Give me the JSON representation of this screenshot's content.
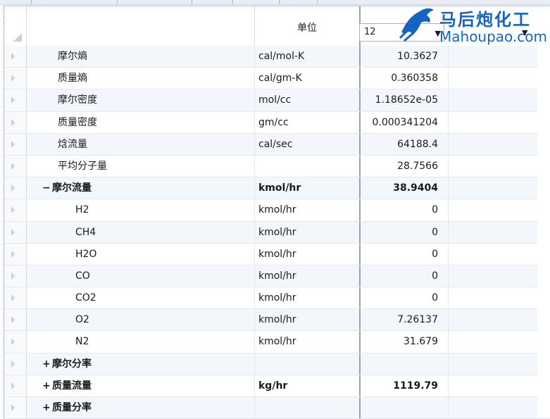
{
  "header": {
    "unit_label": "单位",
    "combo_value": "12"
  },
  "logo": {
    "name": "马后炮化工",
    "url": "Mahoupao.com"
  },
  "rows": [
    {
      "name": "摩尔熵",
      "unit": "cal/mol-K",
      "value": "10.3627",
      "level": 1
    },
    {
      "name": "质量熵",
      "unit": "cal/gm-K",
      "value": "0.360358",
      "level": 1
    },
    {
      "name": "摩尔密度",
      "unit": "mol/cc",
      "value": "1.18652e-05",
      "level": 1
    },
    {
      "name": "质量密度",
      "unit": "gm/cc",
      "value": "0.000341204",
      "level": 1
    },
    {
      "name": "焓流量",
      "unit": "cal/sec",
      "value": "64188.4",
      "level": 1
    },
    {
      "name": "平均分子量",
      "unit": "",
      "value": "28.7566",
      "level": 1
    },
    {
      "name": "摩尔流量",
      "unit": "kmol/hr",
      "value": "38.9404",
      "level": 1,
      "bold": true,
      "expander": "−"
    },
    {
      "name": "H2",
      "unit": "kmol/hr",
      "value": "0",
      "level": 2
    },
    {
      "name": "CH4",
      "unit": "kmol/hr",
      "value": "0",
      "level": 2
    },
    {
      "name": "H2O",
      "unit": "kmol/hr",
      "value": "0",
      "level": 2
    },
    {
      "name": "CO",
      "unit": "kmol/hr",
      "value": "0",
      "level": 2
    },
    {
      "name": "CO2",
      "unit": "kmol/hr",
      "value": "0",
      "level": 2
    },
    {
      "name": "O2",
      "unit": "kmol/hr",
      "value": "7.26137",
      "level": 2
    },
    {
      "name": "N2",
      "unit": "kmol/hr",
      "value": "31.679",
      "level": 2
    },
    {
      "name": "摩尔分率",
      "unit": "",
      "value": "",
      "level": 1,
      "bold": true,
      "expander": "+"
    },
    {
      "name": "质量流量",
      "unit": "kg/hr",
      "value": "1119.79",
      "level": 1,
      "bold": true,
      "expander": "+"
    },
    {
      "name": "质量分率",
      "unit": "",
      "value": "",
      "level": 1,
      "bold": true,
      "expander": "+"
    }
  ]
}
